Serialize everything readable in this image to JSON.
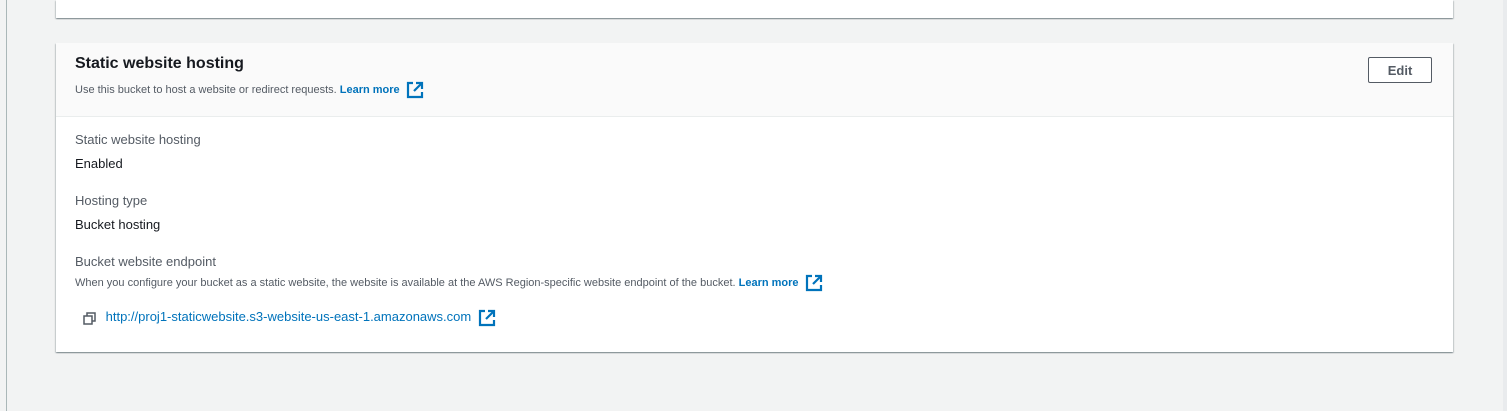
{
  "section": {
    "title": "Static website hosting",
    "description": "Use this bucket to host a website or redirect requests.",
    "learn_more": "Learn more",
    "edit_label": "Edit"
  },
  "fields": {
    "hosting_label": "Static website hosting",
    "hosting_value": "Enabled",
    "type_label": "Hosting type",
    "type_value": "Bucket hosting",
    "endpoint_label": "Bucket website endpoint",
    "endpoint_description": "When you configure your bucket as a static website, the website is available at the AWS Region-specific website endpoint of the bucket.",
    "endpoint_learn_more": "Learn more",
    "endpoint_url": "http://proj1-staticwebsite.s3-website-us-east-1.amazonaws.com"
  },
  "icons": {
    "external": "external-link-icon",
    "copy": "copy-icon"
  },
  "colors": {
    "link": "#0073bb",
    "background": "#f2f3f3",
    "header": "#fafafa"
  }
}
